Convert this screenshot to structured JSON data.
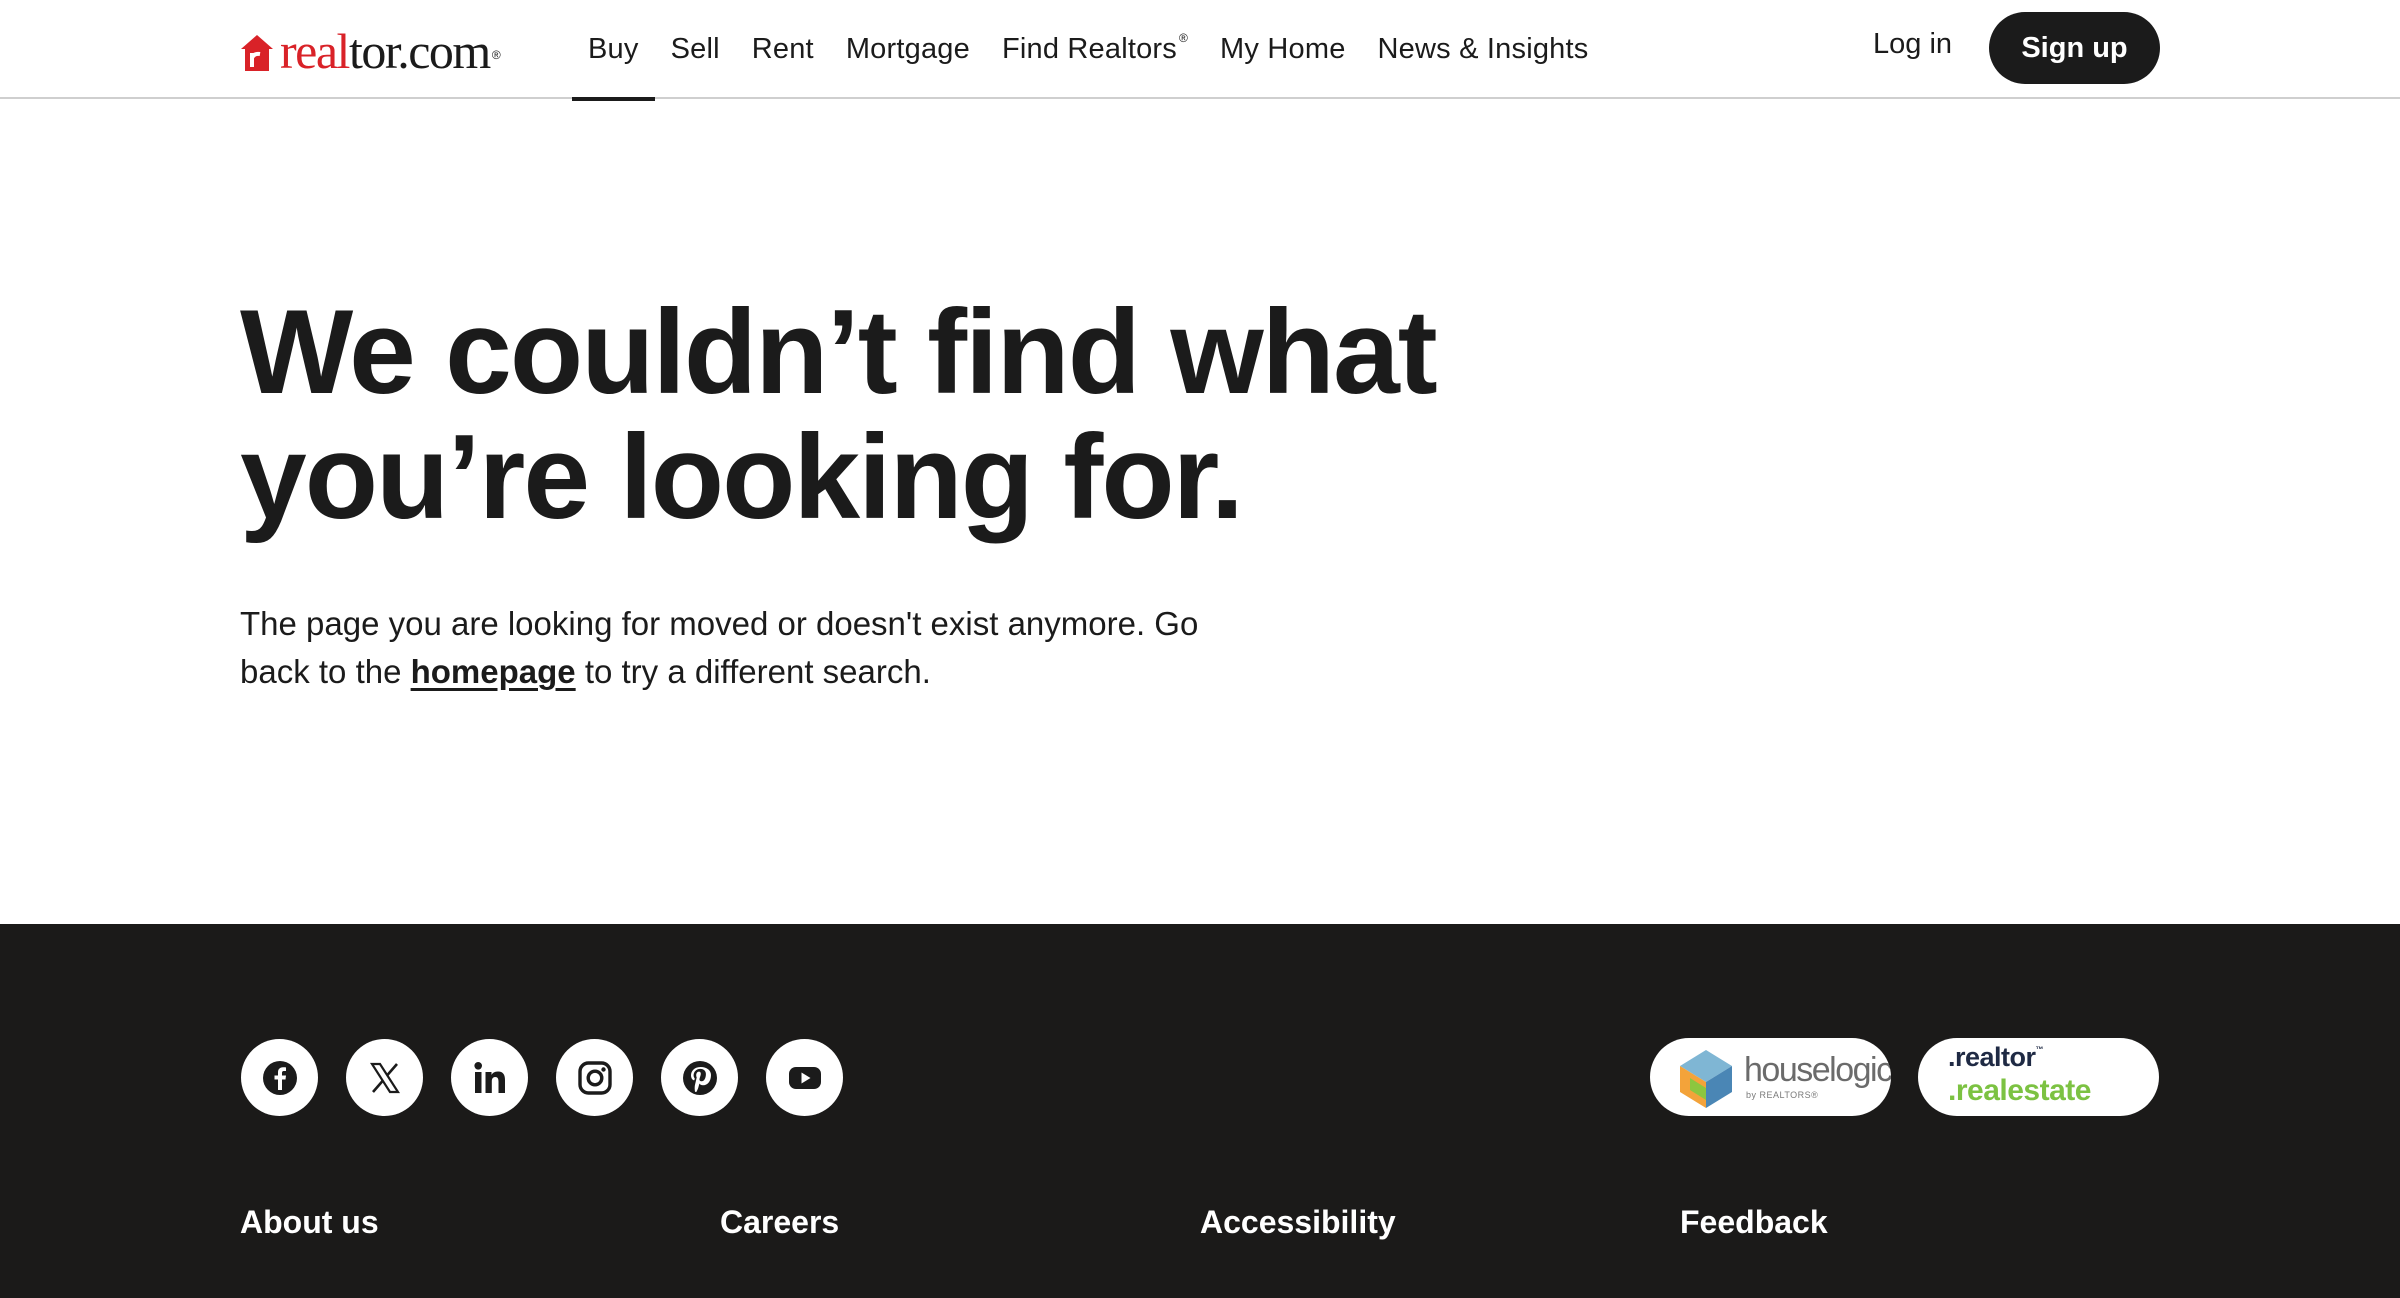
{
  "header": {
    "logo": {
      "text_red": "real",
      "text_dark": "tor.com",
      "mark": "®",
      "icon": "house-r-icon"
    },
    "nav": [
      {
        "label": "Buy",
        "active": true
      },
      {
        "label": "Sell"
      },
      {
        "label": "Rent"
      },
      {
        "label": "Mortgage"
      },
      {
        "label": "Find Realtors",
        "mark": "®"
      },
      {
        "label": "My Home"
      },
      {
        "label": "News & Insights"
      }
    ],
    "login_label": "Log in",
    "signup_label": "Sign up"
  },
  "main": {
    "headline_line1": "We couldn’t find what",
    "headline_line2": "you’re looking for.",
    "desc_part1": "The page you are looking for moved or doesn't exist anymore. Go back to the ",
    "desc_link": "homepage",
    "desc_part2": " to try a different search."
  },
  "footer": {
    "socials": [
      "facebook-icon",
      "x-icon",
      "linkedin-icon",
      "instagram-icon",
      "pinterest-icon",
      "youtube-icon"
    ],
    "partners": {
      "houselogic": {
        "name": "houselogic",
        "sub": "by REALTORS®"
      },
      "realtor_realestate": {
        "top": ".realtor",
        "top_mark": "™",
        "bottom": ".realestate"
      }
    },
    "links": [
      "About us",
      "Careers",
      "Accessibility",
      "Feedback"
    ]
  },
  "colors": {
    "brand_red": "#d92228",
    "text_dark": "#1b1b1b",
    "footer_bg": "#1b1a19",
    "realestate_green": "#7cc242"
  }
}
